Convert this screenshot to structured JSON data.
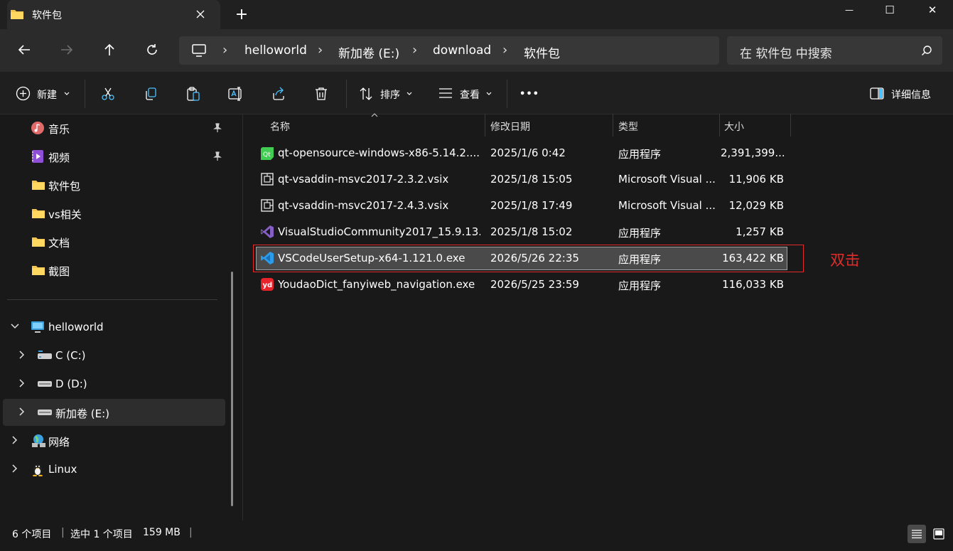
{
  "window": {
    "tab_title": "软件包",
    "new_tab_label": "+",
    "controls": {
      "minimize": "—",
      "maximize": "☐",
      "close": "✕"
    }
  },
  "address": {
    "crumbs": [
      "helloworld",
      "新加卷 (E:)",
      "download",
      "软件包"
    ],
    "separator": "›",
    "search_placeholder": "在 软件包 中搜索"
  },
  "toolbar": {
    "new_label": "新建",
    "sort_label": "排序",
    "view_label": "查看",
    "more_label": "•••",
    "details_label": "详细信息"
  },
  "sidebar": {
    "quick": [
      {
        "label": "音乐",
        "icon": "music-icon",
        "pinned": true
      },
      {
        "label": "视频",
        "icon": "video-icon",
        "pinned": true
      },
      {
        "label": "软件包",
        "icon": "folder-icon"
      },
      {
        "label": "vs相关",
        "icon": "folder-icon"
      },
      {
        "label": "文档",
        "icon": "folder-icon"
      },
      {
        "label": "截图",
        "icon": "folder-icon"
      }
    ],
    "tree": [
      {
        "label": "helloworld",
        "icon": "computer-icon",
        "expanded": true
      },
      {
        "label": "C (C:)",
        "icon": "drive-icon"
      },
      {
        "label": "D (D:)",
        "icon": "drive-icon"
      },
      {
        "label": "新加卷 (E:)",
        "icon": "drive-icon",
        "selected": true
      },
      {
        "label": "网络",
        "icon": "network-icon"
      },
      {
        "label": "Linux",
        "icon": "linux-icon"
      }
    ]
  },
  "columns": {
    "name": "名称",
    "date": "修改日期",
    "type": "类型",
    "size": "大小"
  },
  "files": [
    {
      "name": "qt-opensource-windows-x86-5.14.2....",
      "date": "2025/1/6 0:42",
      "type": "应用程序",
      "size": "2,391,399...",
      "icon": "qt-icon"
    },
    {
      "name": "qt-vsaddin-msvc2017-2.3.2.vsix",
      "date": "2025/1/8 15:05",
      "type": "Microsoft Visual ...",
      "size": "11,906 KB",
      "icon": "vsix-icon"
    },
    {
      "name": "qt-vsaddin-msvc2017-2.4.3.vsix",
      "date": "2025/1/8 17:49",
      "type": "Microsoft Visual ...",
      "size": "12,029 KB",
      "icon": "vsix-icon"
    },
    {
      "name": "VisualStudioCommunity2017_15.9.13....",
      "date": "2025/1/8 15:02",
      "type": "应用程序",
      "size": "1,257 KB",
      "icon": "visual-studio-icon"
    },
    {
      "name": "VSCodeUserSetup-x64-1.121.0.exe",
      "date": "2026/5/26 22:35",
      "type": "应用程序",
      "size": "163,422 KB",
      "icon": "vscode-icon",
      "selected": true
    },
    {
      "name": "YoudaoDict_fanyiweb_navigation.exe",
      "date": "2026/5/25 23:59",
      "type": "应用程序",
      "size": "116,033 KB",
      "icon": "youdao-icon"
    }
  ],
  "annotation": {
    "label": "双击",
    "color": "#e32b2b"
  },
  "status": {
    "count": "6 个项目",
    "selection": "选中 1 个项目",
    "size": "159 MB",
    "divider": "|"
  },
  "colors": {
    "background": "#191919",
    "accent": "#4cc2ff",
    "selection": "#4a4a4a"
  }
}
